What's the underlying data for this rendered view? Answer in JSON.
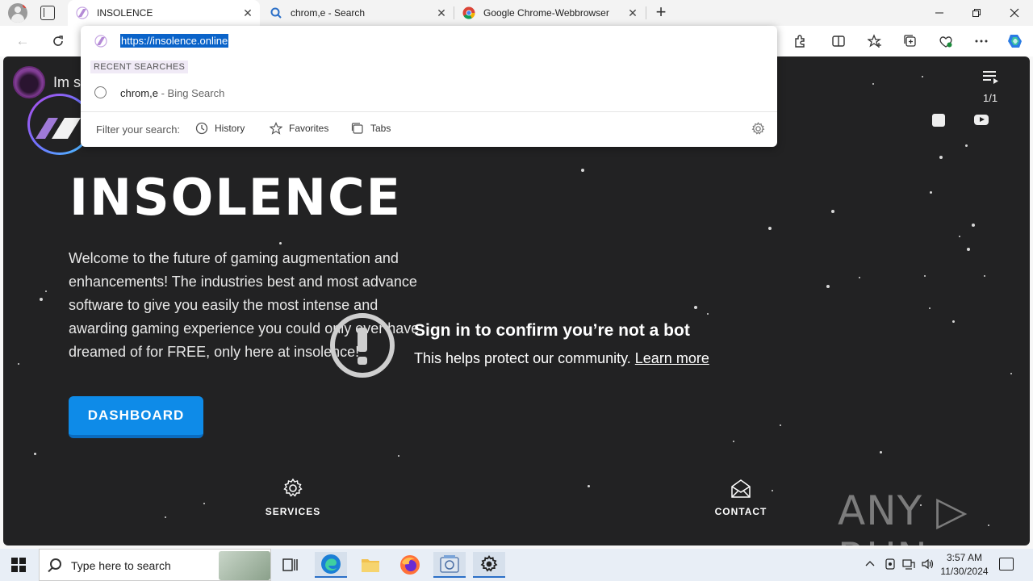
{
  "browser": {
    "tabs": [
      {
        "title": "INSOLENCE",
        "active": true
      },
      {
        "title": "chrom,e - Search",
        "active": false
      },
      {
        "title": "Google Chrome-Webbrowser",
        "active": false
      }
    ],
    "new_tab": "+",
    "address": {
      "url": "https://insolence.online",
      "recent_label": "RECENT SEARCHES",
      "recent_items": [
        {
          "query": "chrom,e",
          "source": " - Bing Search"
        }
      ],
      "filter_label": "Filter your search:",
      "filters": [
        "History",
        "Favorites",
        "Tabs"
      ]
    }
  },
  "page": {
    "video_title": "Im s",
    "playlist_count": "1/1",
    "hero_title": "INSOLENCE",
    "hero_text": "Welcome to the future of gaming augmentation and enhancements! The industries best and most advance software to give you easily the most intense and awarding gaming experience you could only ever have dreamed of for FREE, only here at insolence!",
    "dashboard_label": "DASHBOARD",
    "bot_heading": "Sign in to confirm you’re not a bot",
    "bot_sub": "This helps protect our community. ",
    "bot_link": "Learn more",
    "services_label": "SERVICES",
    "contact_label": "CONTACT",
    "watermark": "ANY ▷ RUN"
  },
  "taskbar": {
    "search_placeholder": "Type here to search",
    "time": "3:57 AM",
    "date": "11/30/2024"
  },
  "colors": {
    "accent": "#0e8be8",
    "page_bg": "#222223",
    "selection": "#0a63c9"
  }
}
